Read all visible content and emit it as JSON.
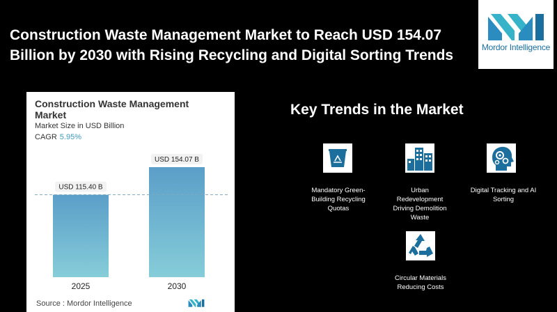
{
  "headline": {
    "line1": "Construction Waste Management Market to Reach USD 154.07",
    "line2": "Billion by 2030 with Rising Recycling and Digital Sorting Trends"
  },
  "logo": {
    "text": "Mordor Intelligence"
  },
  "card": {
    "title_line1": "Construction Waste Management",
    "title_line2": "Market",
    "subtitle": "Market Size in USD Billion",
    "cagr_label": "CAGR",
    "cagr_value": "5.95%",
    "source": "Source :  Mordor Intelligence"
  },
  "chart_data": {
    "type": "bar",
    "title": "Construction Waste Management Market",
    "ylabel": "Market Size in USD Billion",
    "categories": [
      "2025",
      "2030"
    ],
    "values": [
      115.4,
      154.07
    ],
    "value_labels": [
      "USD 115.40 B",
      "USD 154.07 B"
    ],
    "ylim": [
      0,
      154.07
    ],
    "grid": false,
    "colors": {
      "bar_top": "#5b9ec8",
      "bar_bottom": "#86cdd9",
      "dashed_line": "#7fa8c0"
    }
  },
  "trends": {
    "title": "Key Trends in the Market",
    "items": [
      {
        "icon": "recycle-bin-icon",
        "line1": "Mandatory Green-",
        "line2": "Building Recycling",
        "line3": "Quotas",
        "line4": ""
      },
      {
        "icon": "city-buildings-icon",
        "line1": "Urban",
        "line2": "Redevelopment",
        "line3": "Driving Demolition",
        "line4": "Waste"
      },
      {
        "icon": "ai-head-gears-icon",
        "line1": "Digital Tracking and AI",
        "line2": "Sorting",
        "line3": "",
        "line4": ""
      },
      {
        "icon": "recycle-arrows-icon",
        "line1": "Circular Materials",
        "line2": "Reducing Costs",
        "line3": "",
        "line4": ""
      }
    ]
  },
  "colors": {
    "icon_blue": "#1c6f9c",
    "brand_teal": "#36b3c9",
    "brand_blue": "#1b6f9f"
  }
}
